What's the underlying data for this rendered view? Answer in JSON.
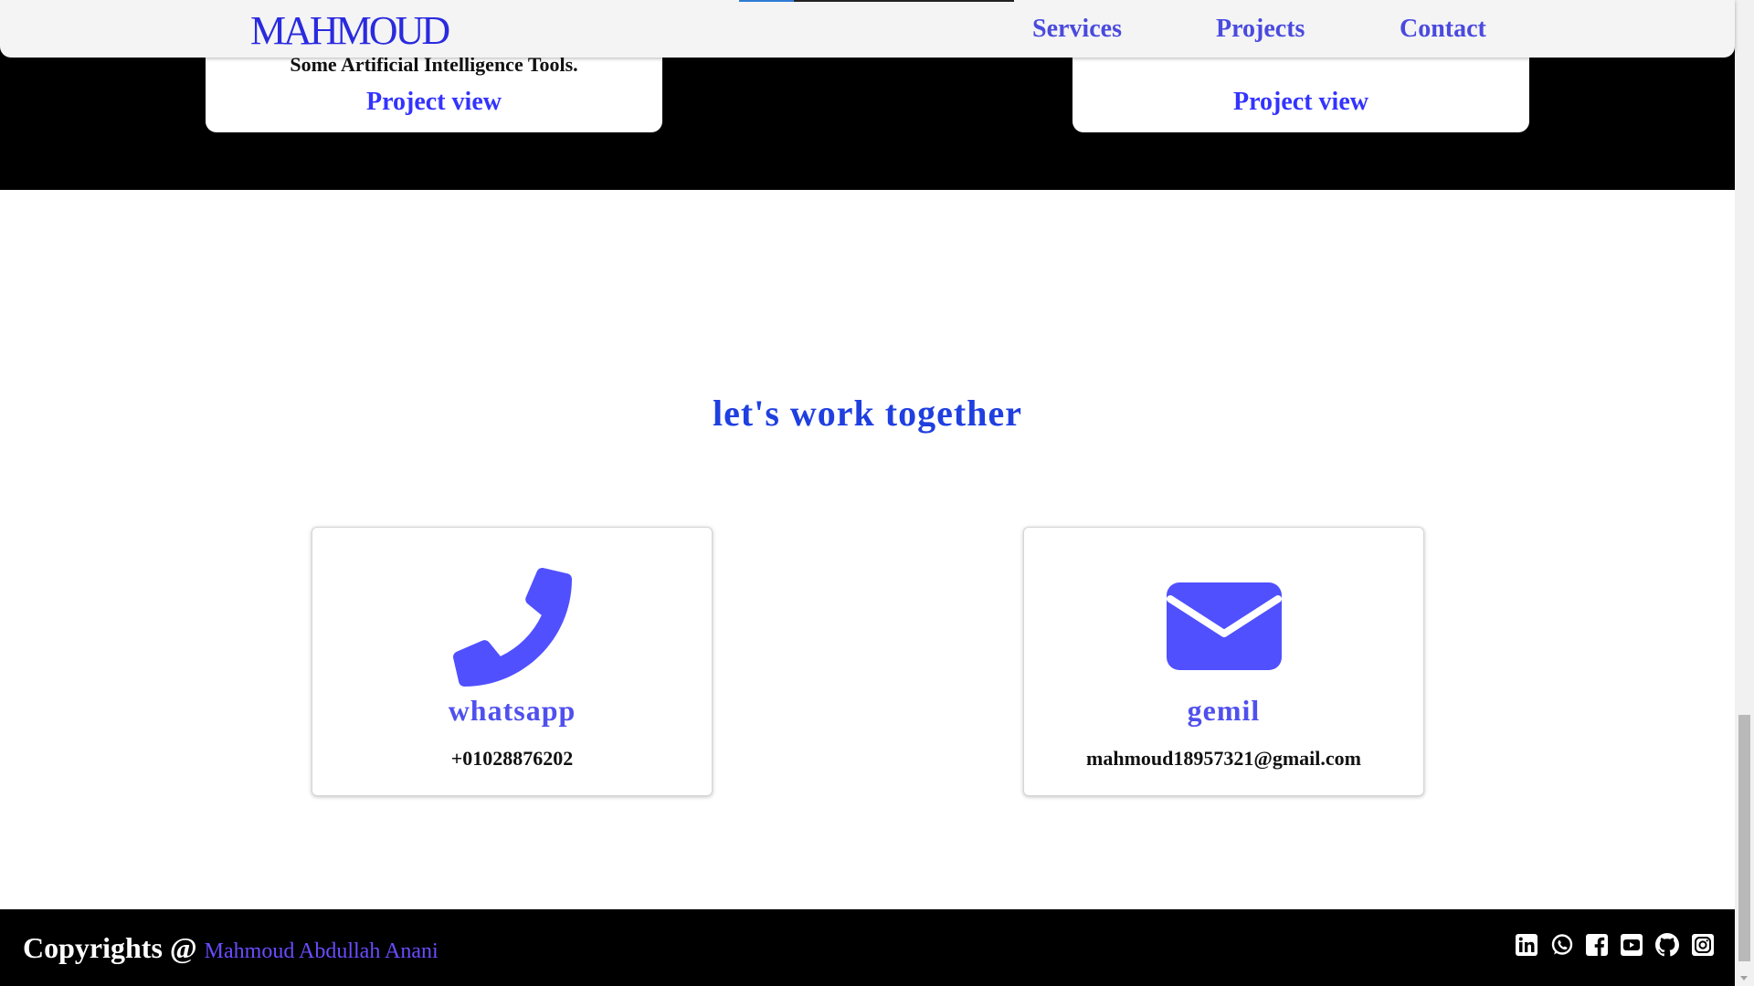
{
  "nav": {
    "brand": "MAHMOUD",
    "links": [
      "Services",
      "Projects",
      "Contact"
    ],
    "scroll_progress_fraction": 0.2
  },
  "projects": {
    "cards": [
      {
        "description": "Some Artificial Intelligence Tools.",
        "link": "Project view"
      },
      {
        "description": "",
        "link": "Project view"
      }
    ]
  },
  "contact": {
    "heading": "let's work together",
    "cards": [
      {
        "icon": "phone-icon",
        "title": "whatsapp",
        "value": "+01028876202"
      },
      {
        "icon": "envelope-icon",
        "title": "gemil",
        "value": "mahmoud18957321@gmail.com"
      }
    ]
  },
  "footer": {
    "copyright_prefix": "Copyrights @",
    "name": "Mahmoud Abdullah Anani",
    "social_icons": [
      "linkedin-icon",
      "whatsapp-icon",
      "facebook-icon",
      "youtube-icon",
      "github-icon",
      "instagram-icon"
    ]
  },
  "colors": {
    "accent": "#4a4adf",
    "brand": "#2a2adf",
    "heading": "#1f3fe0",
    "icon": "#5050ff",
    "footer_name": "#6a4cff"
  }
}
